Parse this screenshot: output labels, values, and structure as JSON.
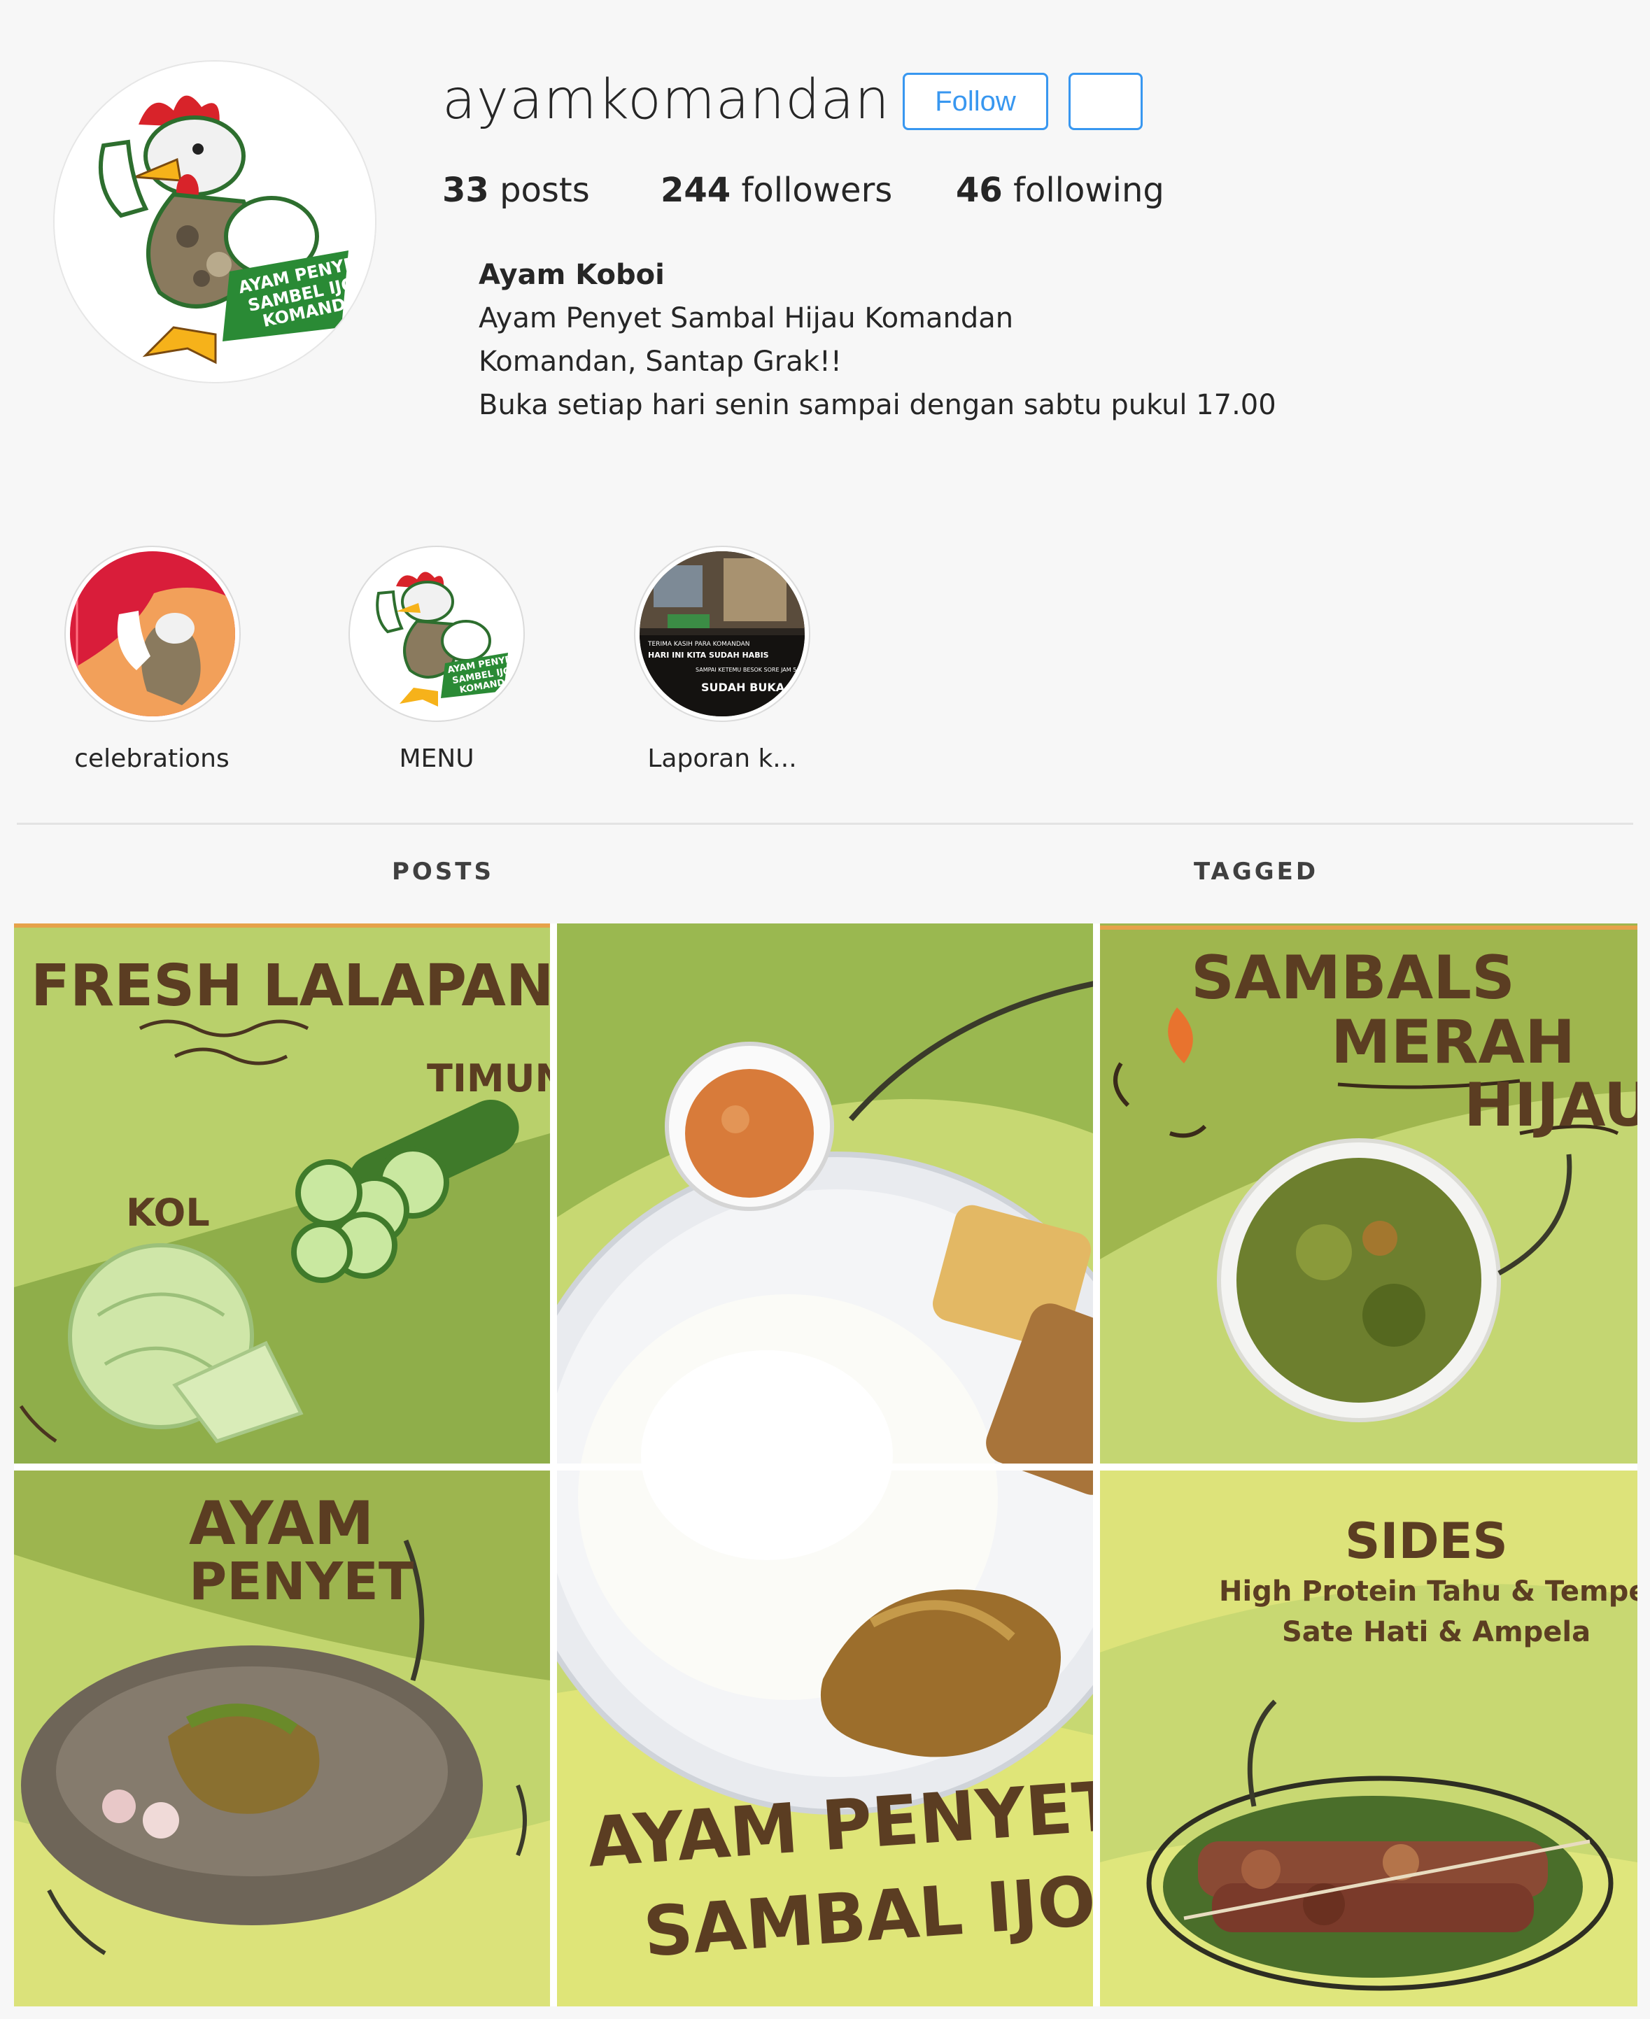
{
  "profile": {
    "username": "ayamkomandan",
    "follow_label": "Follow",
    "posts_count": "33",
    "posts_label": "posts",
    "followers_count": "244",
    "followers_label": "followers",
    "following_count": "46",
    "following_label": "following",
    "bio_name": "Ayam Koboi",
    "bio_lines": [
      "Ayam Penyet Sambal Hijau Komandan",
      "Komandan, Santap Grak!!",
      "Buka setiap hari senin sampai dengan sabtu pukul 17.00"
    ],
    "logo_text": [
      "AYAM PENYET",
      "SAMBEL IJO",
      "KOMANDAN"
    ]
  },
  "highlights": [
    {
      "label": "celebrations"
    },
    {
      "label": "MENU",
      "logo_text": [
        "AYAM PENYET",
        "SAMBEL IJO",
        "KOMANDAN"
      ]
    },
    {
      "label": "Laporan k...",
      "text": [
        "TERIMA KASIH PARA KOMANDAN",
        "HARI INI KITA SUDAH HABIS",
        "SAMPAI KETEMU BESOK SORE JAM 5",
        "SUDAH BUKA"
      ]
    }
  ],
  "tabs": {
    "posts": "POSTS",
    "tagged": "TAGGED"
  },
  "posts": {
    "fresh_title": "FRESH LALAPAN",
    "timun": "TIMUN",
    "kol": "KOL",
    "sambals": [
      "SAMBALS",
      "MERAH",
      "HIJAU"
    ],
    "ayam_penyet": [
      "AYAM",
      "PENYET"
    ],
    "sides_title": "SIDES",
    "sides_lines": [
      "High Protein Tahu & Tempe",
      "Sate Hati & Ampela"
    ],
    "bottom_title": [
      "AYAM PENYET",
      "SAMBAL IJO"
    ]
  },
  "colors": {
    "accent": "#3897f0",
    "poster_green": "#b5d06a",
    "poster_dark": "#8fae4a",
    "poster_yellow": "#dde47a",
    "text_brown": "#5b3d22"
  }
}
